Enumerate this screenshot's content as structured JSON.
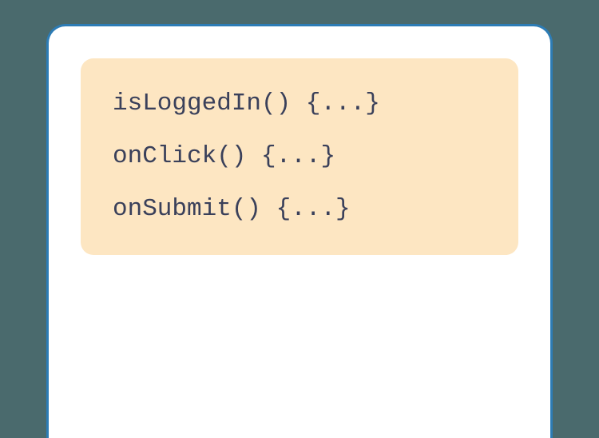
{
  "code": {
    "lines": [
      "isLoggedIn() {...}",
      "onClick() {...}",
      "onSubmit() {...}"
    ]
  }
}
